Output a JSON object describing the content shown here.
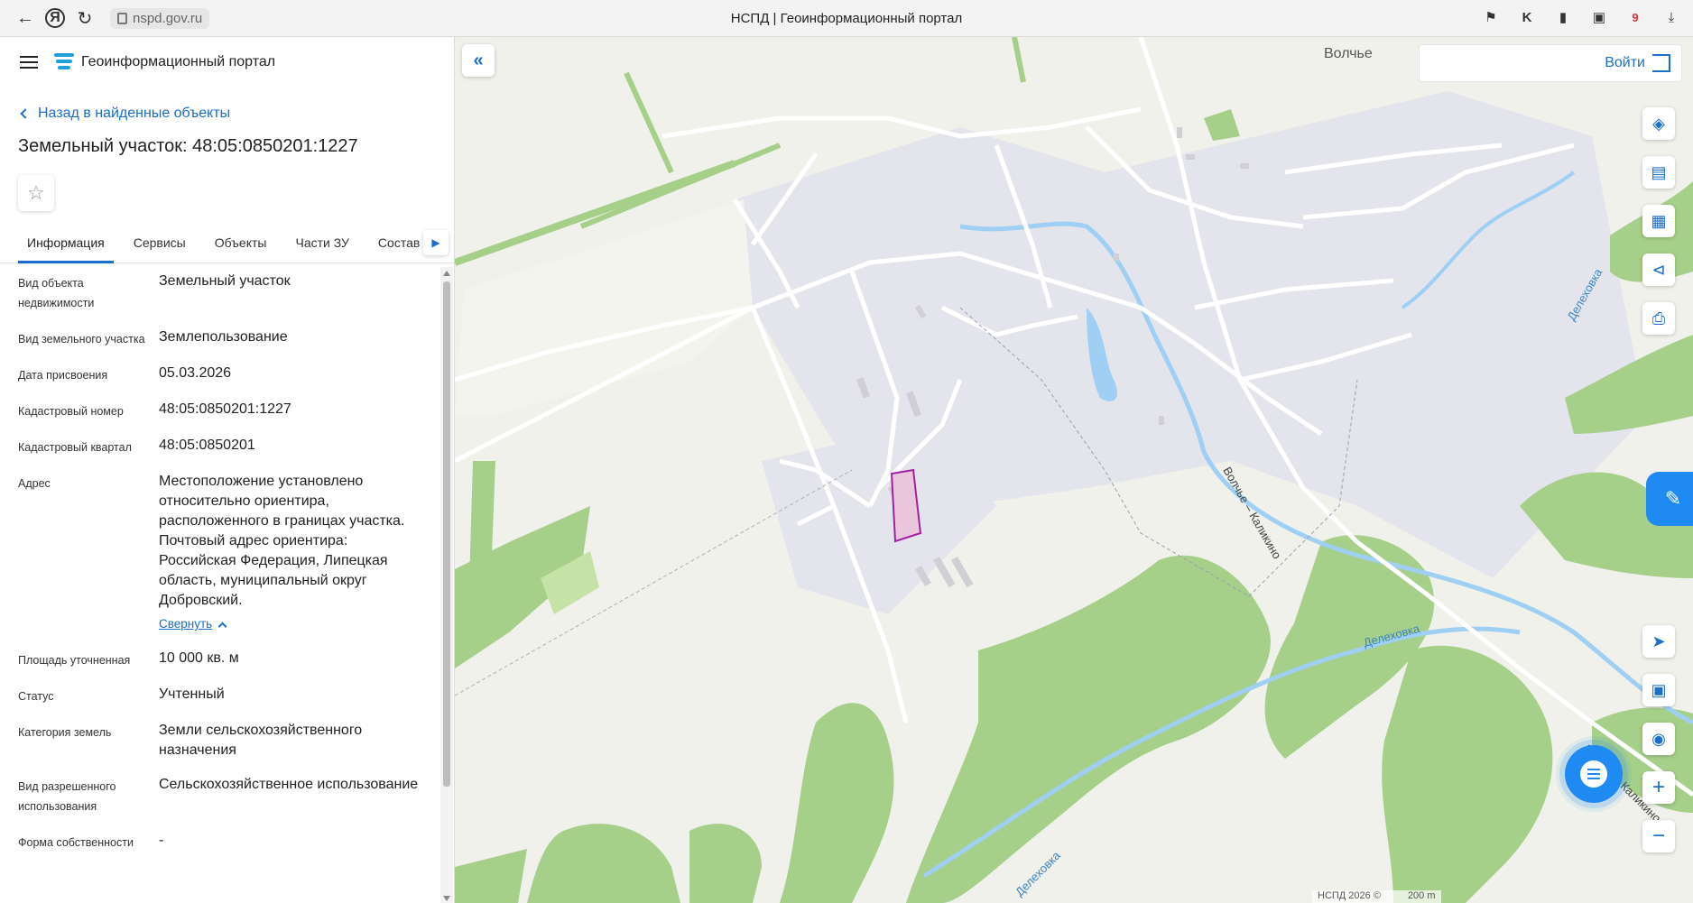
{
  "browser": {
    "url": "nspd.gov.ru",
    "tab_title": "НСПД | Геоинформационный портал",
    "extension_badge": "9"
  },
  "header": {
    "portal_title": "Геоинформационный портал"
  },
  "back_link": "Назад в найденные объекты",
  "parcel_title": "Земельный участок: 48:05:0850201:1227",
  "tabs": [
    {
      "label": "Информация"
    },
    {
      "label": "Сервисы"
    },
    {
      "label": "Объекты"
    },
    {
      "label": "Части ЗУ"
    },
    {
      "label": "Состав"
    }
  ],
  "info": {
    "object_type_label": "Вид объекта недвижимости",
    "object_type_value": "Земельный участок",
    "land_kind_label": "Вид земельного участка",
    "land_kind_value": "Землепользование",
    "date_label": "Дата присвоения",
    "date_value": "05.03.2026",
    "cadastral_number_label": "Кадастровый номер",
    "cadastral_number_value": "48:05:0850201:1227",
    "cadastral_quarter_label": "Кадастровый квартал",
    "cadastral_quarter_value": "48:05:0850201",
    "address_label": "Адрес",
    "address_value": "Местоположение установлено относительно ориентира, расположенного в границах участка. Почтовый адрес ориентира: Российская Федерация, Липецкая область, муниципальный округ Добровский.",
    "collapse_label": "Свернуть",
    "area_label": "Площадь уточненная",
    "area_value": "10 000 кв. м",
    "status_label": "Статус",
    "status_value": "Учтенный",
    "category_label": "Категория земель",
    "category_value": "Земли сельскохозяйственного назначения",
    "permitted_use_label": "Вид разрешенного использования",
    "permitted_use_value": "Сельскохозяйственное использование",
    "ownership_label": "Форма собственности",
    "ownership_value": "-"
  },
  "map": {
    "login_label": "Войти",
    "labels": {
      "village": "Волчье",
      "road_1": "Волчье – Каликино",
      "road_2": "Волчье – Каликино",
      "river_1": "Делеховка",
      "river_2": "Делеховка",
      "river_3": "Делеховка"
    },
    "copyright": "НСПД 2026 ©",
    "scale": "200 m"
  },
  "colors": {
    "accent": "#1a6ecc",
    "forest": "#a6cf8a",
    "water": "#9fd0f3",
    "parcel_fill": "#e8c7dd",
    "parcel_stroke": "#a0219e"
  }
}
